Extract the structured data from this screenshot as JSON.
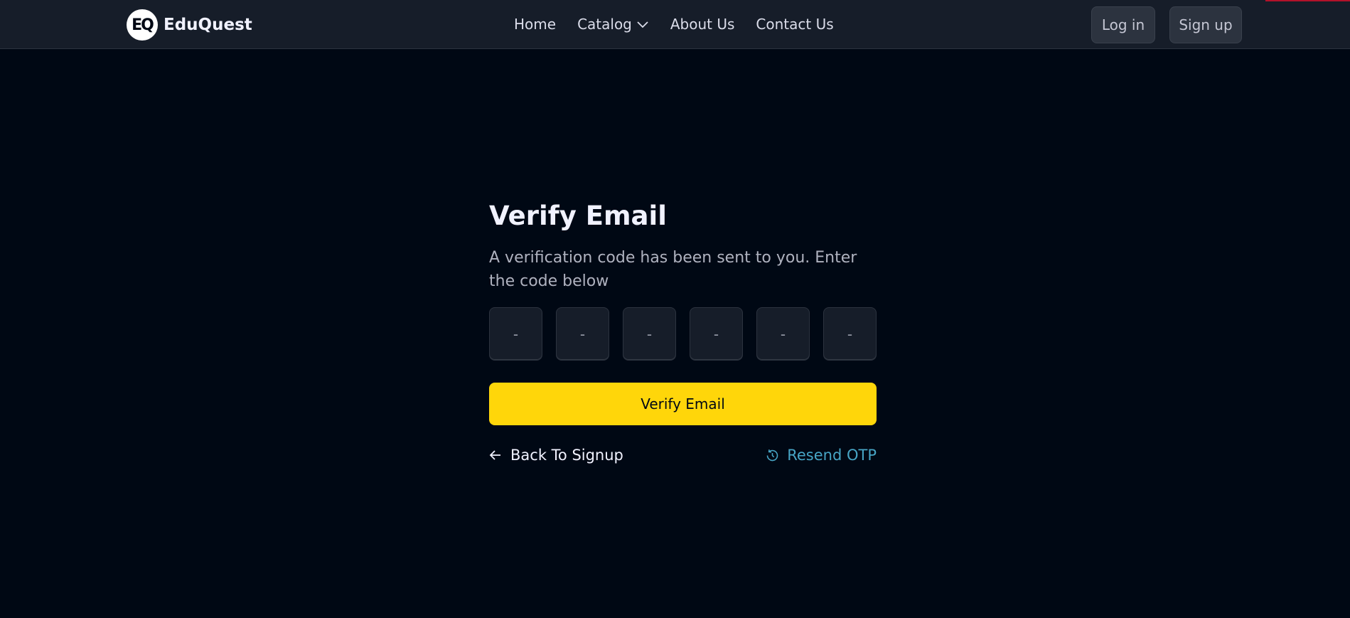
{
  "header": {
    "logo_badge": "EQ",
    "logo_text": "EduQuest",
    "nav": [
      {
        "label": "Home"
      },
      {
        "label": "Catalog",
        "icon": "chevron-down-icon"
      },
      {
        "label": "About Us"
      },
      {
        "label": "Contact Us"
      }
    ],
    "login_label": "Log in",
    "signup_label": "Sign up"
  },
  "verify": {
    "title": "Verify Email",
    "subtitle": "A verification code has been sent to you. Enter the code below",
    "otp_placeholder": "-",
    "button_label": "Verify Email",
    "back_label": "Back To Signup",
    "back_icon": "arrow-left-icon",
    "resend_label": "Resend OTP",
    "resend_icon": "history-icon"
  },
  "colors": {
    "background": "#000814",
    "header": "#161d29",
    "accent_yellow": "#ffd60a",
    "link_blue": "#47a5c5"
  }
}
